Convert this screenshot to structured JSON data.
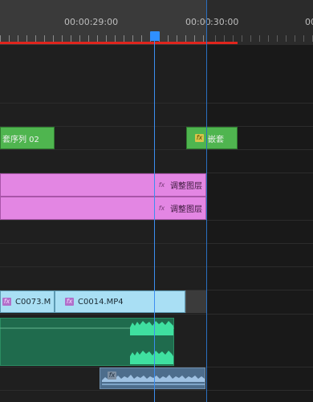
{
  "ruler": {
    "timecode_1": "00:00:29:00",
    "timecode_2_a": "00:00",
    "timecode_2_b": ":30:00",
    "timecode_3": "00"
  },
  "clips": {
    "nested_seq_label": "套序列 02",
    "nested_label": "嵌套",
    "adjust_layer_1": "调整图层",
    "adjust_layer_2": "调整图层",
    "video_clip_1": "C0073.M",
    "video_clip_2": "C0014.MP4",
    "fx_badge": "fx"
  },
  "colors": {
    "playhead": "#3c8ef0",
    "in_out_bar": "#e0251d",
    "nested_clip": "#4fb54f",
    "adjustment_layer": "#e386e3",
    "video_clip": "#a9dff4",
    "audio_clip_1": "#1f6b4d",
    "audio_clip_2": "#4d6d8c"
  }
}
